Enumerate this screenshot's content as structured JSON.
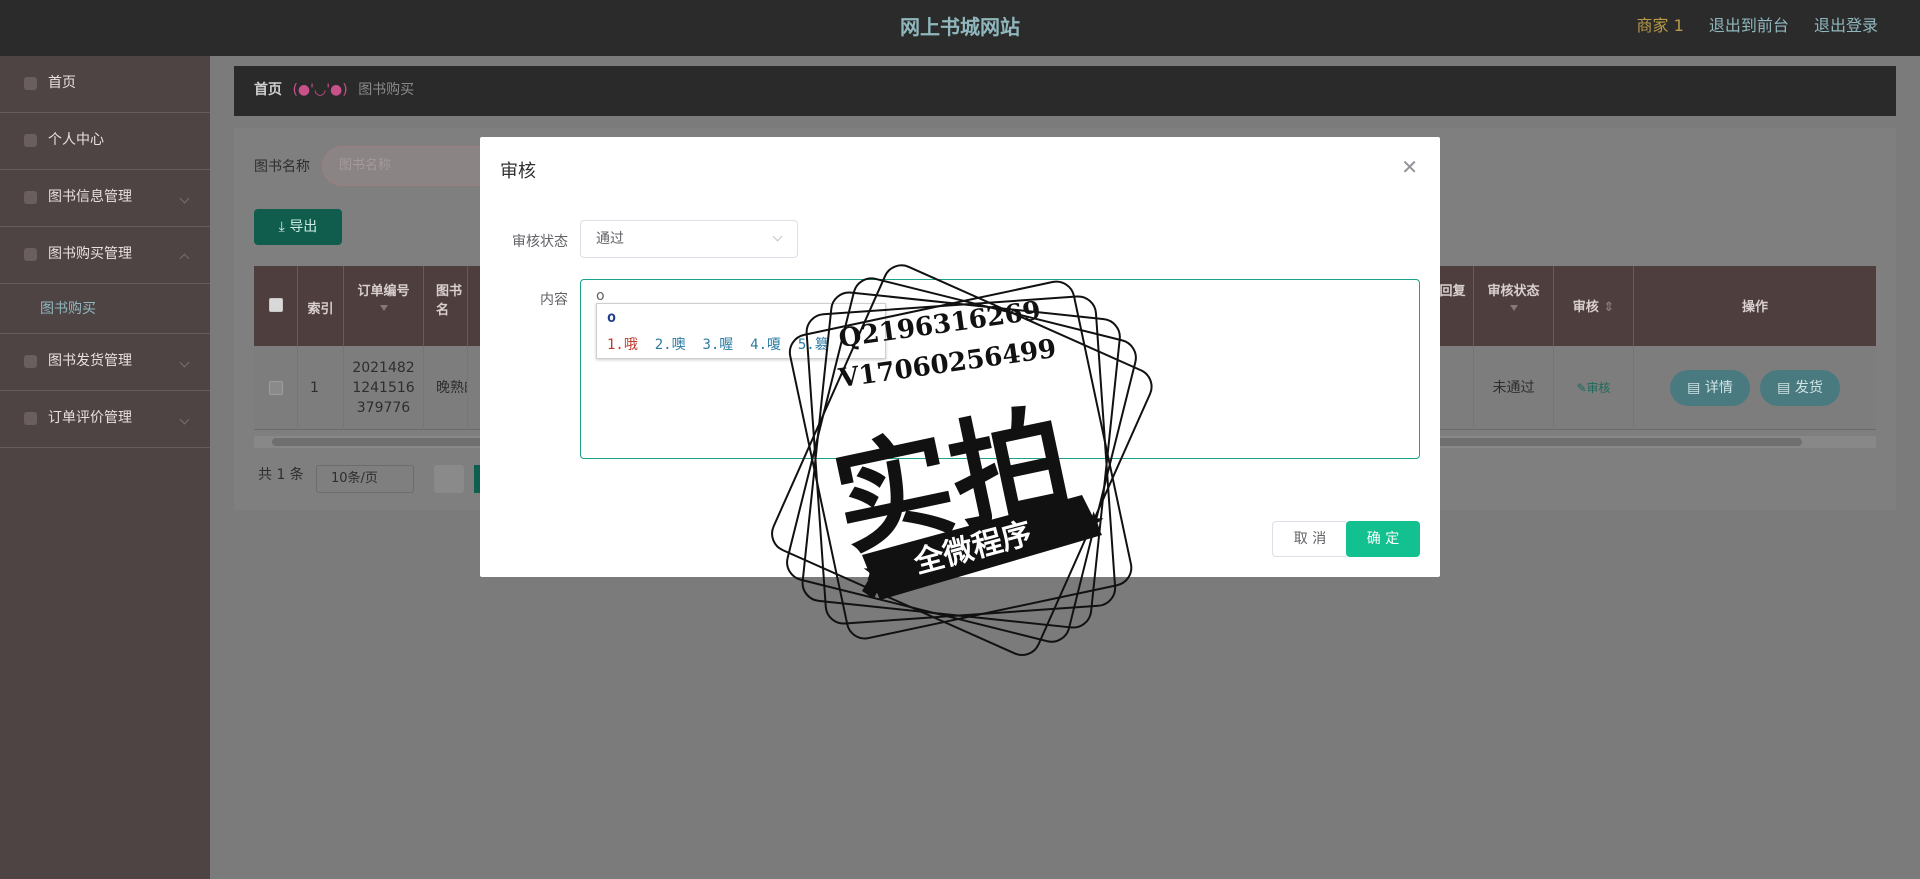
{
  "header": {
    "site_title": "网上书城网站",
    "merchant": "商家 1",
    "front_link": "退出到前台",
    "logout_link": "退出登录"
  },
  "sidebar": {
    "items": [
      {
        "label": "首页"
      },
      {
        "label": "个人中心"
      },
      {
        "label": "图书信息管理"
      },
      {
        "label": "图书购买管理"
      },
      {
        "label": "图书购买"
      },
      {
        "label": "图书发货管理"
      },
      {
        "label": "订单评价管理"
      }
    ]
  },
  "breadcrumb": {
    "home": "首页",
    "face": "(●'◡'●)",
    "current": "图书购买"
  },
  "search": {
    "label": "图书名称",
    "placeholder": "图书名称"
  },
  "toolbar": {
    "export_label": "导出"
  },
  "table": {
    "columns": [
      "索引",
      "订单编号",
      "图书名",
      "回复",
      "审核状态",
      "审核",
      "操作"
    ],
    "row": {
      "index": "1",
      "order_no_lines": [
        "2021482",
        "1241516",
        "379776"
      ],
      "book_partial": "晚熟的",
      "audit_status": "未通过",
      "audit_link": "审核",
      "detail_btn": "详情",
      "ship_btn": "发货"
    }
  },
  "pager": {
    "total": "共 1 条",
    "page_size": "10条/页"
  },
  "dialog": {
    "title": "审核",
    "status_label": "审核状态",
    "status_value": "通过",
    "content_label": "内容",
    "content_value": "o",
    "cancel_label": "取 消",
    "ok_label": "确 定"
  },
  "ime": {
    "composition": "o",
    "candidates": [
      "1.哦",
      "2.噢",
      "3.喔",
      "4.嗄",
      "5.篡"
    ]
  },
  "watermark": {
    "qq": "Q2196316269",
    "vx": "V17060256499",
    "big": "实拍",
    "banner": "全微程序"
  }
}
